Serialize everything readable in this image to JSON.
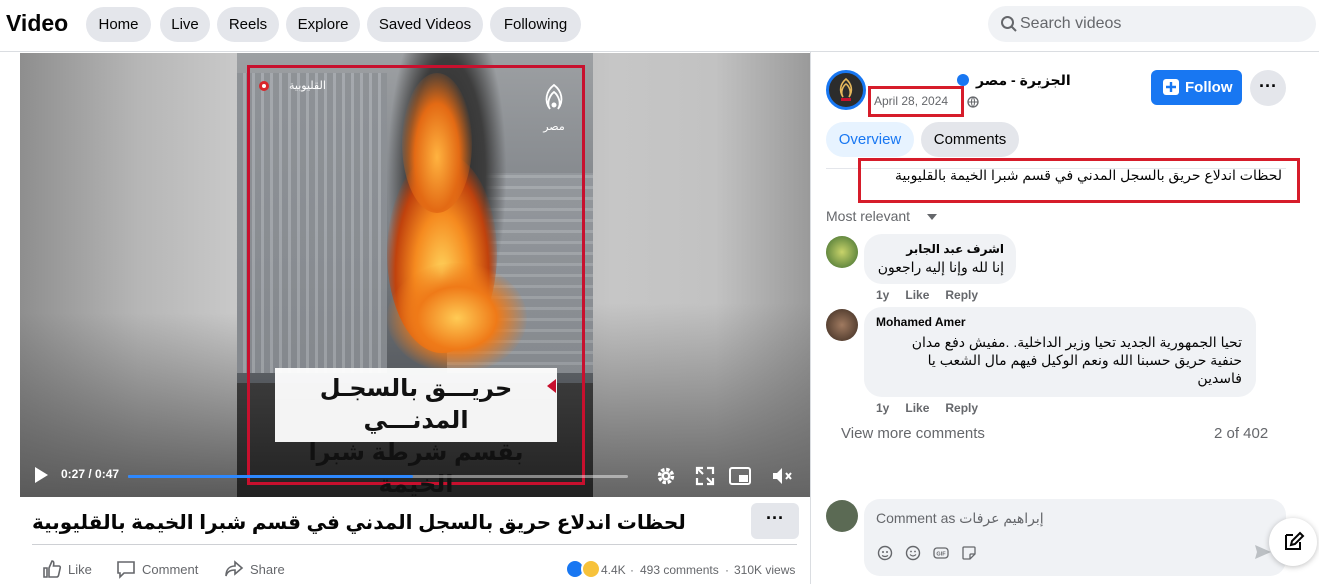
{
  "header": {
    "brand": "Video",
    "nav": [
      "Home",
      "Live",
      "Reels",
      "Explore",
      "Saved Videos",
      "Following"
    ],
    "search_placeholder": "Search videos"
  },
  "video": {
    "overlay_location": "القليوبية",
    "overlay_logo_text": "مصر",
    "overlay_caption_line1": "حريـــق بالسجـل المدنـــي",
    "overlay_caption_line2": "بقسم شرطة شبرا الخيمة",
    "time": "0:27 / 0:47",
    "progress": 0.57,
    "title": "لحظات اندلاع حريق بالسجل المدني في قسم شبرا الخيمة بالقليوبية",
    "more": "···"
  },
  "actions": {
    "like": "Like",
    "comment": "Comment",
    "share": "Share",
    "reactions_count": "4.4K",
    "comments_count": "493 comments",
    "views": "310K views",
    "separator": "·"
  },
  "sidebar": {
    "page_name": "الجزيرة - مصر",
    "date": "April 28, 2024",
    "follow_label": "Follow",
    "more": "···",
    "tabs": [
      "Overview",
      "Comments"
    ],
    "description": "لحظات اندلاع حريق بالسجل المدني في قسم شبرا الخيمة بالقليوبية",
    "sort_label": "Most relevant",
    "comments": [
      {
        "author": "اشرف عبد الجابر",
        "text": "إنا لله وإنا إليه راجعون",
        "age": "1y",
        "like": "Like",
        "reply": "Reply"
      },
      {
        "author": "Mohamed Amer",
        "text": "تحيا الجمهورية الجديد تحيا وزير الداخلية. .مفيش دفع مدان حنفية حريق حسبنا الله ونعم الوكيل فيهم مال الشعب يا فاسدين",
        "age": "1y",
        "like": "Like",
        "reply": "Reply"
      }
    ],
    "view_more": "View more comments",
    "count": "2 of 402",
    "composer_placeholder": "Comment as إبراهيم عرفات"
  },
  "colors": {
    "accent": "#1877f2",
    "highlight_box": "#d61c2a"
  }
}
